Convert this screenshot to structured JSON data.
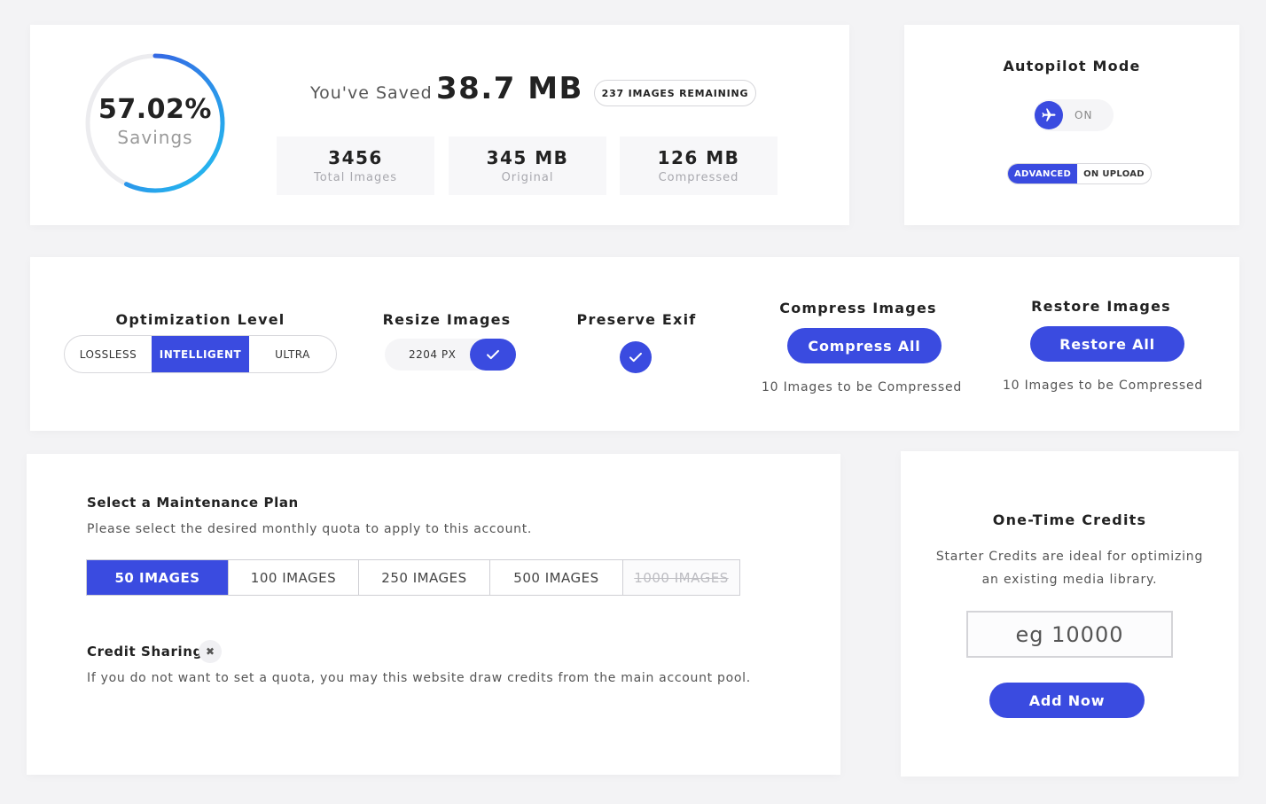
{
  "savings": {
    "percent": "57.02%",
    "percent_label": "Savings",
    "percent_value": 57.02,
    "saved_label": "You've Saved",
    "saved_value": "38.7 MB",
    "remaining": "237 IMAGES REMAINING",
    "stats": [
      {
        "value": "3456",
        "label": "Total Images"
      },
      {
        "value": "345 MB",
        "label": "Original"
      },
      {
        "value": "126 MB",
        "label": "Compressed"
      }
    ]
  },
  "autopilot": {
    "title": "Autopilot Mode",
    "toggle_label": "ON",
    "toggle_icon": "airplane-icon",
    "segments": [
      "ADVANCED",
      "ON UPLOAD"
    ],
    "active_segment": "ADVANCED"
  },
  "optimization": {
    "title": "Optimization Level",
    "levels": [
      "LOSSLESS",
      "INTELLIGENT",
      "ULTRA"
    ],
    "active_level": "INTELLIGENT"
  },
  "resize": {
    "title": "Resize Images",
    "value": "2204 PX",
    "checked": true
  },
  "exif": {
    "title": "Preserve Exif",
    "checked": true
  },
  "compress": {
    "title": "Compress Images",
    "button": "Compress All",
    "note": "10 Images to be Compressed"
  },
  "restore": {
    "title": "Restore Images",
    "button": "Restore All",
    "note": "10 Images to be Compressed"
  },
  "plan": {
    "title": "Select a Maintenance Plan",
    "description": "Please select the desired monthly quota to apply to this account.",
    "options": [
      "50 IMAGES",
      "100 IMAGES",
      "250 IMAGES",
      "500 IMAGES",
      "1000 IMAGES"
    ],
    "active_option": "50 IMAGES",
    "disabled_option": "1000 IMAGES"
  },
  "credit_sharing": {
    "title": "Credit Sharing",
    "close_glyph": "✖",
    "description": "If you do not want to set a quota, you may this website draw credits from the main account pool."
  },
  "credits": {
    "title": "One-Time Credits",
    "description": "Starter Credits are ideal for optimizing an existing media library.",
    "input_placeholder": "eg 10000",
    "button": "Add Now"
  },
  "colors": {
    "accent": "#3a4be0",
    "ring_start": "#3a4be0",
    "ring_end": "#22c3f0",
    "background": "#f3f3f5"
  }
}
